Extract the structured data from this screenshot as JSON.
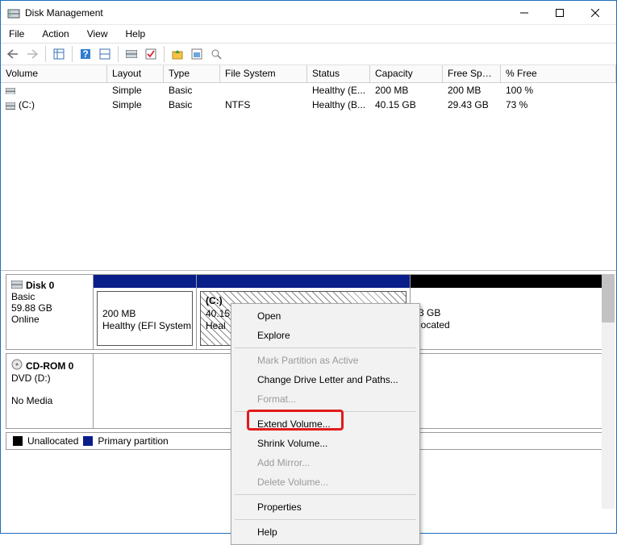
{
  "window": {
    "title": "Disk Management"
  },
  "menu": {
    "file": "File",
    "action": "Action",
    "view": "View",
    "help": "Help"
  },
  "columns": {
    "volume": "Volume",
    "layout": "Layout",
    "type": "Type",
    "fs": "File System",
    "status": "Status",
    "capacity": "Capacity",
    "free": "Free Spa...",
    "pct": "% Free"
  },
  "rows": [
    {
      "vol": "",
      "layout": "Simple",
      "type": "Basic",
      "fs": "",
      "status": "Healthy (E...",
      "cap": "200 MB",
      "free": "200 MB",
      "pct": "100 %"
    },
    {
      "vol": "(C:)",
      "layout": "Simple",
      "type": "Basic",
      "fs": "NTFS",
      "status": "Healthy (B...",
      "cap": "40.15 GB",
      "free": "29.43 GB",
      "pct": "73 %"
    }
  ],
  "disk0": {
    "name": "Disk 0",
    "type": "Basic",
    "size": "59.88 GB",
    "state": "Online",
    "p1": {
      "size": "200 MB",
      "status": "Healthy (EFI System P"
    },
    "p2": {
      "label": "(C:)",
      "size": "40.15",
      "status": "Heal"
    },
    "p3": {
      "size_suffix": "3 GB",
      "status": "located"
    }
  },
  "cdrom": {
    "name": "CD-ROM 0",
    "drive": "DVD (D:)",
    "state": "No Media"
  },
  "legend": {
    "unalloc": "Unallocated",
    "primary": "Primary partition"
  },
  "colors": {
    "primary": "#0a1e8a",
    "unalloc": "#000000"
  },
  "ctx": {
    "open": "Open",
    "explore": "Explore",
    "mark": "Mark Partition as Active",
    "letter": "Change Drive Letter and Paths...",
    "format": "Format...",
    "extend": "Extend Volume...",
    "shrink": "Shrink Volume...",
    "mirror": "Add Mirror...",
    "delete": "Delete Volume...",
    "props": "Properties",
    "help": "Help"
  }
}
